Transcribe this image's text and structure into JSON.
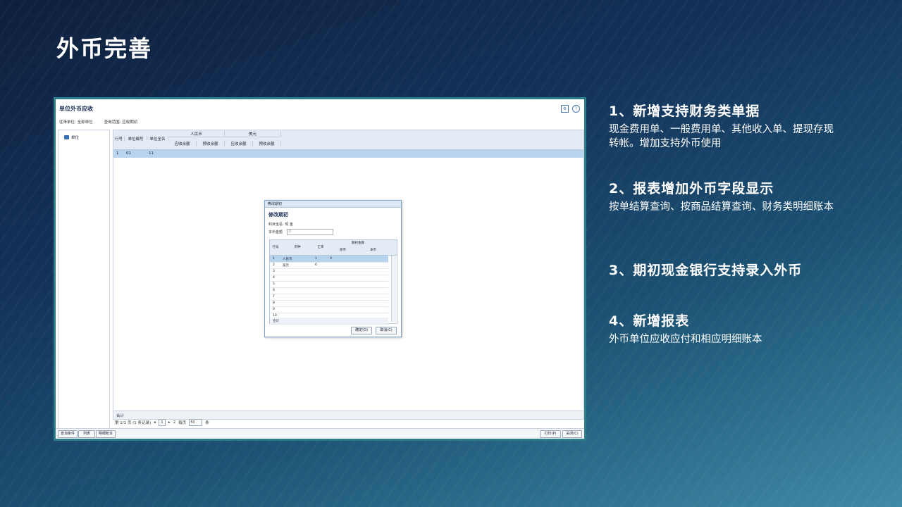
{
  "slide": {
    "title": "外币完善"
  },
  "app": {
    "title": "单位外币应收",
    "filters": [
      "往来单位: 全部单位",
      "查询范围: 应收期初"
    ],
    "tree_node": "单位",
    "grid_headers": {
      "row_no": "行号",
      "unit_code": "单位编号",
      "unit_name": "单位全名",
      "group1": "人民币",
      "group2": "美元",
      "sub1": "应收余额",
      "sub2": "预收余额",
      "sub3": "应收余额",
      "sub4": "预收余额"
    },
    "grid_row": {
      "row_no": "1",
      "unit_code": "01",
      "unit_name": "11"
    },
    "grid_sum_label": "合计",
    "pager": {
      "text": "第 1/1 页 (1 条记录)",
      "page": "1",
      "total": "2",
      "per_page_label": "每页",
      "per_page": "50",
      "unit": "条"
    },
    "bottom_buttons": [
      "查询条件",
      "列表",
      "明细账本"
    ],
    "right_buttons": [
      "打印(P)",
      "关闭(C)"
    ]
  },
  "dialog": {
    "window_title": "修改期初",
    "heading": "修改期初",
    "subject_label": "科目全名:",
    "subject_value": "现 金",
    "local_label": "本币金额",
    "local_value": "0",
    "columns": {
      "row_no": "行号",
      "currency": "币种",
      "rate": "汇率",
      "group": "期初金额",
      "orig": "原币",
      "local": "本币"
    },
    "rows": [
      {
        "no": "1",
        "currency": "人民币",
        "rate": "1",
        "orig": "0"
      },
      {
        "no": "2",
        "currency": "美元",
        "rate": "6",
        "orig": ""
      },
      {
        "no": "3",
        "currency": "",
        "rate": "",
        "orig": ""
      },
      {
        "no": "4",
        "currency": "",
        "rate": "",
        "orig": ""
      },
      {
        "no": "5",
        "currency": "",
        "rate": "",
        "orig": ""
      },
      {
        "no": "6",
        "currency": "",
        "rate": "",
        "orig": ""
      },
      {
        "no": "7",
        "currency": "",
        "rate": "",
        "orig": ""
      },
      {
        "no": "8",
        "currency": "",
        "rate": "",
        "orig": ""
      },
      {
        "no": "9",
        "currency": "",
        "rate": "",
        "orig": ""
      },
      {
        "no": "10",
        "currency": "",
        "rate": "",
        "orig": ""
      }
    ],
    "sum_label": "合计",
    "ok": "确定(O)",
    "cancel": "取消(C)"
  },
  "features": [
    {
      "title": "1、新增支持财务类单据",
      "desc": "现金费用单、一般费用单、其他收入单、提现存现转帐。增加支持外币使用"
    },
    {
      "title": "2、报表增加外币字段显示",
      "desc": "按单结算查询、按商品结算查询、财务类明细账本"
    },
    {
      "title": "3、期初现金银行支持录入外币",
      "desc": ""
    },
    {
      "title": "4、新增报表",
      "desc": "外币单位应收应付和相应明细账本"
    }
  ]
}
